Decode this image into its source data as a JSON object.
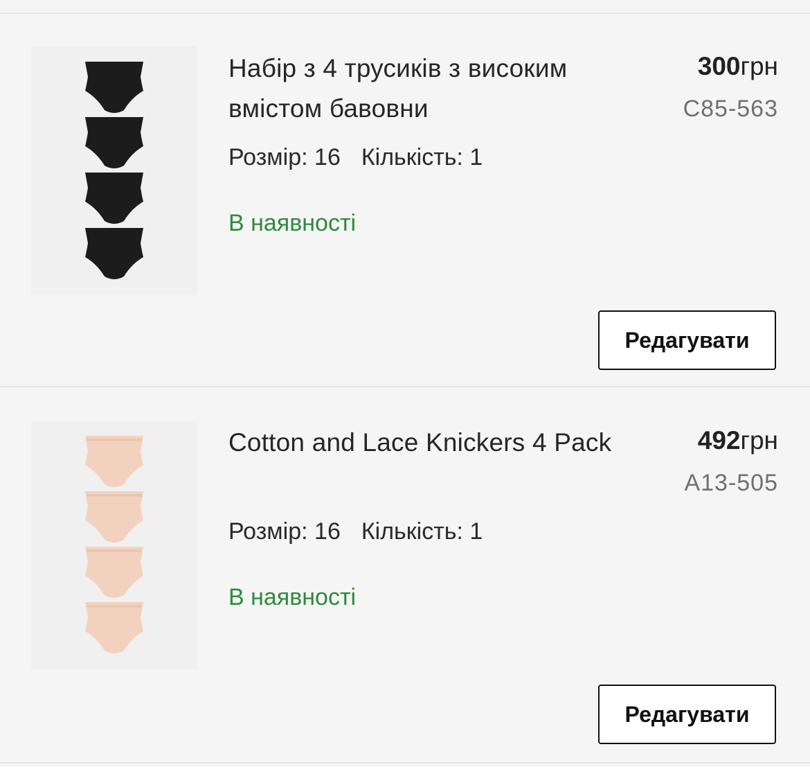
{
  "items": [
    {
      "title": "Набір з 4 трусиків з високим вмістом бавовни",
      "price_amount": "300",
      "price_currency": "грн",
      "sku": "C85-563",
      "size_label": "Розмір: 16",
      "quantity_label": "Кількість: 1",
      "stock_status": "В наявності",
      "edit_label": "Редагувати",
      "image_color": "#1c1c1c"
    },
    {
      "title": "Cotton and Lace Knickers 4 Pack",
      "price_amount": "492",
      "price_currency": "грн",
      "sku": "A13-505",
      "size_label": "Розмір: 16",
      "quantity_label": "Кількість: 1",
      "stock_status": "В наявності",
      "edit_label": "Редагувати",
      "image_color": "#f2d2bf"
    }
  ],
  "colors": {
    "in_stock": "#2e8b3a",
    "sku_text": "#707070",
    "background": "#f5f5f5"
  }
}
